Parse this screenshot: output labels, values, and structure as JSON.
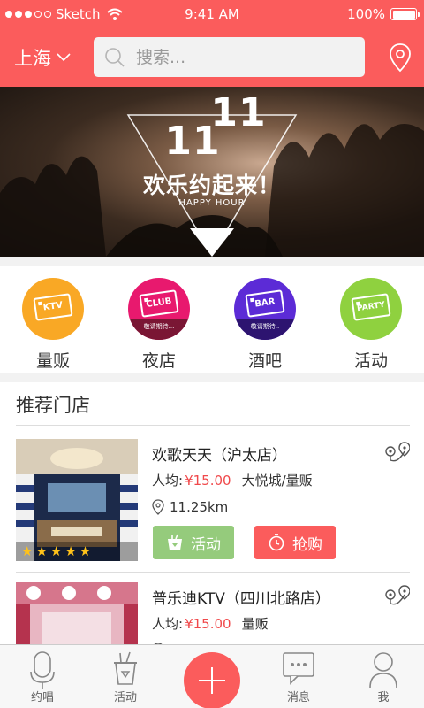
{
  "status_bar": {
    "carrier": "Sketch",
    "time": "9:41 AM",
    "battery": "100%"
  },
  "header": {
    "city": "上海",
    "search_placeholder": "搜索...",
    "icons": [
      "chevron-down-icon",
      "search-icon",
      "location-pin-icon"
    ]
  },
  "banner": {
    "number_back": "11",
    "number_front": "11",
    "title": "欢乐约起来！",
    "subtitle": "HAPPY HOUR"
  },
  "categories": [
    {
      "label": "量贩",
      "ticket": "KTV",
      "color": "#f9a825",
      "coming_soon": ""
    },
    {
      "label": "夜店",
      "ticket": "CLUB",
      "color": "#e8196e",
      "coming_soon": "敬请期待..."
    },
    {
      "label": "酒吧",
      "ticket": "BAR",
      "color": "#5c2bd6",
      "coming_soon": "敬请期待.."
    },
    {
      "label": "活动",
      "ticket": "PARTY",
      "color": "#8fd13f",
      "coming_soon": ""
    }
  ],
  "recommended": {
    "title": "推荐门店",
    "stores": [
      {
        "name": "欢歌天天（沪太店）",
        "price_label": "人均:",
        "price": "¥15.00",
        "tags": "大悦城/量贩",
        "distance": "11.25km",
        "rating": "★★★★★",
        "activity_label": "活动",
        "buy_label": "抢购"
      },
      {
        "name": "普乐迪KTV（四川北路店）",
        "price_label": "人均:",
        "price": "¥15.00",
        "tags": "量贩"
      }
    ]
  },
  "tabbar": {
    "tabs": [
      {
        "label": "约唱",
        "icon": "microphone-icon"
      },
      {
        "label": "活动",
        "icon": "ice-bucket-icon"
      },
      {
        "label": "",
        "icon": "plus-icon"
      },
      {
        "label": "消息",
        "icon": "message-icon"
      },
      {
        "label": "我",
        "icon": "user-icon"
      }
    ]
  },
  "colors": {
    "primary": "#fb5c5c",
    "price": "#f0494b",
    "activity_button": "#95cb7c",
    "star": "#ffc21a"
  }
}
